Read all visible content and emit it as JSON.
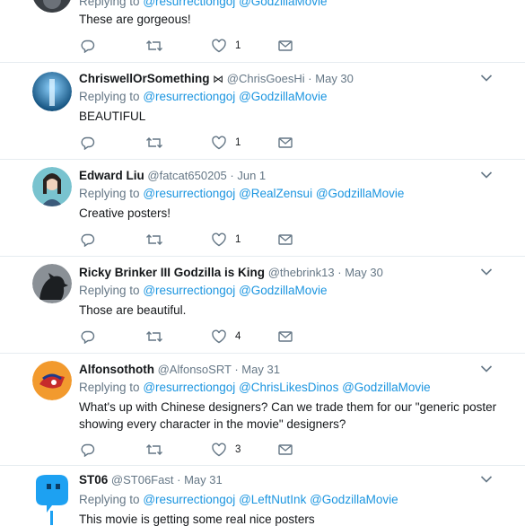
{
  "tweets": [
    {
      "name": "",
      "badge": "",
      "handle": "@resurrectiongoj",
      "date": "",
      "reply_label": "Replying to",
      "mentions": [
        "@resurrectiongoj",
        "@GodzillaMovie"
      ],
      "text": "These are gorgeous!",
      "likes": "1",
      "avatar_color": "#3a3f44"
    },
    {
      "name": "ChriswellOrSomething",
      "badge": "⋈",
      "handle": "@ChrisGoesHi",
      "date": "May 30",
      "reply_label": "Replying to",
      "mentions": [
        "@resurrectiongoj",
        "@GodzillaMovie"
      ],
      "text": "BEAUTIFUL",
      "likes": "1",
      "avatar_color": "#1f6f9f"
    },
    {
      "name": "Edward Liu",
      "badge": "",
      "handle": "@fatcat650205",
      "date": "Jun 1",
      "reply_label": "Replying to",
      "mentions": [
        "@resurrectiongoj",
        "@RealZensui",
        "@GodzillaMovie"
      ],
      "text": "Creative posters!",
      "likes": "1",
      "avatar_color": "#5fa9b8"
    },
    {
      "name": "Ricky Brinker III Godzilla is King",
      "badge": "",
      "handle": "@thebrink13",
      "date": "May 30",
      "reply_label": "Replying to",
      "mentions": [
        "@resurrectiongoj",
        "@GodzillaMovie"
      ],
      "text": "Those are beautiful.",
      "likes": "4",
      "avatar_color": "#2b2e33"
    },
    {
      "name": "Alfonsothoth",
      "badge": "",
      "handle": "@AlfonsoSRT",
      "date": "May 31",
      "reply_label": "Replying to",
      "mentions": [
        "@resurrectiongoj",
        "@ChrisLikesDinos",
        "@GodzillaMovie"
      ],
      "text_lines": [
        "What's up with Chinese designers? Can we trade them for our \"generic poster",
        "showing every character in the movie\" designers?"
      ],
      "likes": "3",
      "avatar_color": "#e8872a"
    },
    {
      "name": "ST06",
      "badge": "",
      "handle": "@ST06Fast",
      "date": "May 31",
      "reply_label": "Replying to",
      "mentions": [
        "@resurrectiongoj",
        "@LeftNutInk",
        "@GodzillaMovie"
      ],
      "text": "This movie is getting some real nice posters",
      "likes": "",
      "avatar_color": "#1da1f2"
    }
  ],
  "separator": "·",
  "colors": {
    "link": "#1b95e0",
    "secondary": "#657786",
    "icon": "#657786",
    "border": "#e6ecf0"
  },
  "icons": [
    "reply-icon",
    "retweet-icon",
    "like-icon",
    "dm-icon",
    "chevron-down-icon"
  ]
}
